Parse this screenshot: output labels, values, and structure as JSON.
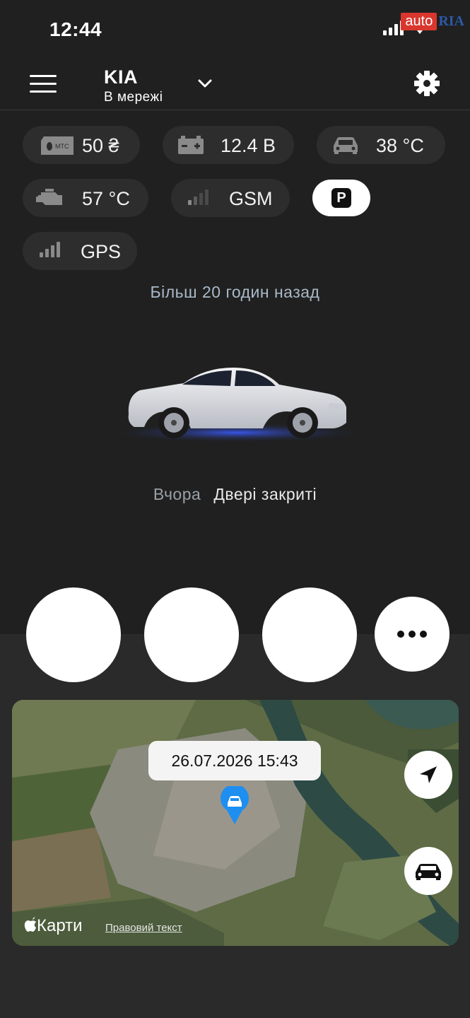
{
  "status_bar": {
    "time": "12:44"
  },
  "watermark": {
    "auto": "auto",
    "ria": "RIA"
  },
  "header": {
    "title": "KIA",
    "subtitle": "В мережі"
  },
  "chips": {
    "balance": {
      "icon": "sim-icon",
      "value": "50 ₴"
    },
    "battery": {
      "icon": "battery-icon",
      "value": "12.4 В"
    },
    "cabin_temp": {
      "icon": "car-icon",
      "value": "38 °C"
    },
    "engine_temp": {
      "icon": "engine-icon",
      "value": "57 °C"
    },
    "gsm": {
      "icon": "signal-icon",
      "value": "GSM"
    },
    "parking": {
      "icon": "parking-icon",
      "label": "P"
    },
    "gps": {
      "icon": "signal-icon",
      "value": "GPS"
    }
  },
  "last_seen": "Більш 20 годин назад",
  "doors": {
    "when": "Вчора",
    "state": "Двері закриті"
  },
  "map": {
    "timestamp": "26.07.2026 15:43",
    "maps_label": "Карти",
    "legal_label": "Правовий текст"
  },
  "colors": {
    "background": "#202020",
    "chip": "#2d2d2d",
    "accent_pin": "#1e8ef0",
    "underglow": "#2a4bff"
  }
}
